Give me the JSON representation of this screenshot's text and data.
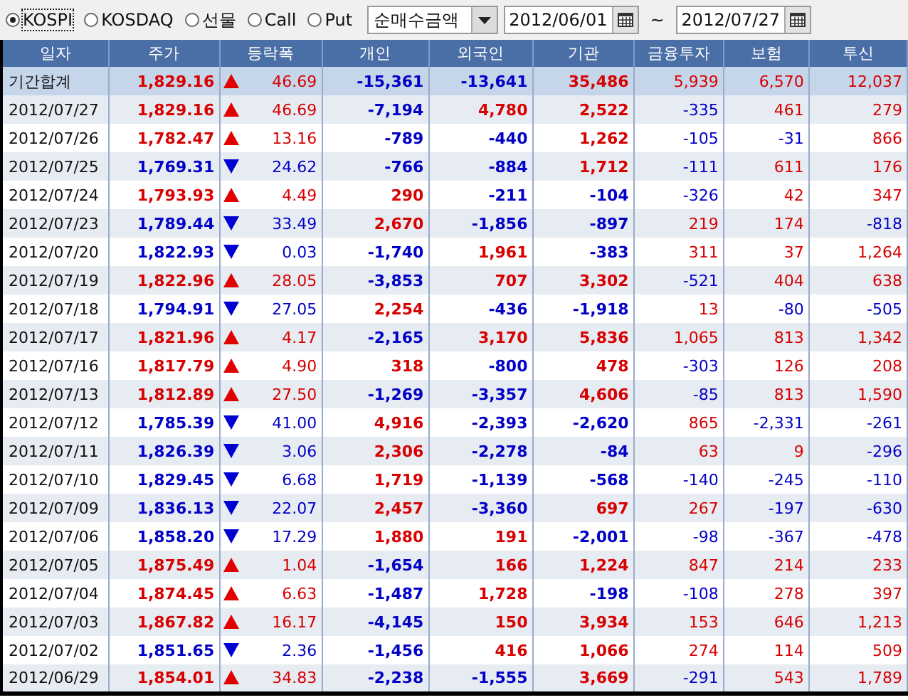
{
  "markets": [
    {
      "label": "KOSPI",
      "selected": true
    },
    {
      "label": "KOSDAQ",
      "selected": false
    },
    {
      "label": "선물",
      "selected": false
    },
    {
      "label": "Call",
      "selected": false
    },
    {
      "label": "Put",
      "selected": false
    }
  ],
  "metric_dropdown": {
    "value": "순매수금액"
  },
  "date_from": {
    "value": "2012/06/01"
  },
  "range_sep": "~",
  "date_to": {
    "value": "2012/07/27"
  },
  "table": {
    "columns": [
      "일자",
      "주가",
      "등락폭",
      "개인",
      "외국인",
      "기관",
      "금융투자",
      "보험",
      "투신"
    ],
    "rows": [
      {
        "kind": "total",
        "date": "기간합계",
        "price": "1,829.16",
        "rising": true,
        "change": "46.69",
        "values": [
          "-15,361",
          "-13,641",
          "35,486",
          "5,939",
          "6,570",
          "12,037"
        ]
      },
      {
        "kind": "day",
        "date": "2012/07/27",
        "price": "1,829.16",
        "rising": true,
        "change": "46.69",
        "values": [
          "-7,194",
          "4,780",
          "2,522",
          "-335",
          "461",
          "279"
        ]
      },
      {
        "kind": "day",
        "date": "2012/07/26",
        "price": "1,782.47",
        "rising": true,
        "change": "13.16",
        "values": [
          "-789",
          "-440",
          "1,262",
          "-105",
          "-31",
          "866"
        ]
      },
      {
        "kind": "day",
        "date": "2012/07/25",
        "price": "1,769.31",
        "rising": false,
        "change": "24.62",
        "values": [
          "-766",
          "-884",
          "1,712",
          "-111",
          "611",
          "176"
        ]
      },
      {
        "kind": "day",
        "date": "2012/07/24",
        "price": "1,793.93",
        "rising": true,
        "change": "4.49",
        "values": [
          "290",
          "-211",
          "-104",
          "-326",
          "42",
          "347"
        ]
      },
      {
        "kind": "day",
        "date": "2012/07/23",
        "price": "1,789.44",
        "rising": false,
        "change": "33.49",
        "values": [
          "2,670",
          "-1,856",
          "-897",
          "219",
          "174",
          "-818"
        ]
      },
      {
        "kind": "day",
        "date": "2012/07/20",
        "price": "1,822.93",
        "rising": false,
        "change": "0.03",
        "values": [
          "-1,740",
          "1,961",
          "-383",
          "311",
          "37",
          "1,264"
        ]
      },
      {
        "kind": "day",
        "date": "2012/07/19",
        "price": "1,822.96",
        "rising": true,
        "change": "28.05",
        "values": [
          "-3,853",
          "707",
          "3,302",
          "-521",
          "404",
          "638"
        ]
      },
      {
        "kind": "day",
        "date": "2012/07/18",
        "price": "1,794.91",
        "rising": false,
        "change": "27.05",
        "values": [
          "2,254",
          "-436",
          "-1,918",
          "13",
          "-80",
          "-505"
        ]
      },
      {
        "kind": "day",
        "date": "2012/07/17",
        "price": "1,821.96",
        "rising": true,
        "change": "4.17",
        "values": [
          "-2,165",
          "3,170",
          "5,836",
          "1,065",
          "813",
          "1,342"
        ]
      },
      {
        "kind": "day",
        "date": "2012/07/16",
        "price": "1,817.79",
        "rising": true,
        "change": "4.90",
        "values": [
          "318",
          "-800",
          "478",
          "-303",
          "126",
          "208"
        ]
      },
      {
        "kind": "day",
        "date": "2012/07/13",
        "price": "1,812.89",
        "rising": true,
        "change": "27.50",
        "values": [
          "-1,269",
          "-3,357",
          "4,606",
          "-85",
          "813",
          "1,590"
        ]
      },
      {
        "kind": "day",
        "date": "2012/07/12",
        "price": "1,785.39",
        "rising": false,
        "change": "41.00",
        "values": [
          "4,916",
          "-2,393",
          "-2,620",
          "865",
          "-2,331",
          "-261"
        ]
      },
      {
        "kind": "day",
        "date": "2012/07/11",
        "price": "1,826.39",
        "rising": false,
        "change": "3.06",
        "values": [
          "2,306",
          "-2,278",
          "-84",
          "63",
          "9",
          "-296"
        ]
      },
      {
        "kind": "day",
        "date": "2012/07/10",
        "price": "1,829.45",
        "rising": false,
        "change": "6.68",
        "values": [
          "1,719",
          "-1,139",
          "-568",
          "-140",
          "-245",
          "-110"
        ]
      },
      {
        "kind": "day",
        "date": "2012/07/09",
        "price": "1,836.13",
        "rising": false,
        "change": "22.07",
        "values": [
          "2,457",
          "-3,360",
          "697",
          "267",
          "-197",
          "-630"
        ]
      },
      {
        "kind": "day",
        "date": "2012/07/06",
        "price": "1,858.20",
        "rising": false,
        "change": "17.29",
        "values": [
          "1,880",
          "191",
          "-2,001",
          "-98",
          "-367",
          "-478"
        ]
      },
      {
        "kind": "day",
        "date": "2012/07/05",
        "price": "1,875.49",
        "rising": true,
        "change": "1.04",
        "values": [
          "-1,654",
          "166",
          "1,224",
          "847",
          "214",
          "233"
        ]
      },
      {
        "kind": "day",
        "date": "2012/07/04",
        "price": "1,874.45",
        "rising": true,
        "change": "6.63",
        "values": [
          "-1,487",
          "1,728",
          "-198",
          "-108",
          "278",
          "397"
        ]
      },
      {
        "kind": "day",
        "date": "2012/07/03",
        "price": "1,867.82",
        "rising": true,
        "change": "16.17",
        "values": [
          "-4,145",
          "150",
          "3,934",
          "153",
          "646",
          "1,213"
        ]
      },
      {
        "kind": "day",
        "date": "2012/07/02",
        "price": "1,851.65",
        "rising": false,
        "change": "2.36",
        "values": [
          "-1,456",
          "416",
          "1,066",
          "274",
          "114",
          "509"
        ]
      },
      {
        "kind": "day",
        "date": "2012/06/29",
        "price": "1,854.01",
        "rising": true,
        "change": "34.83",
        "values": [
          "-2,238",
          "-1,555",
          "3,669",
          "-291",
          "543",
          "1,789"
        ]
      }
    ]
  }
}
